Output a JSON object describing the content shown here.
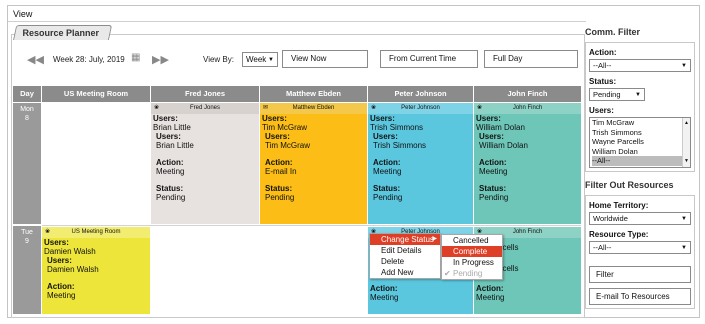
{
  "page": {
    "view_label": "View"
  },
  "planner": {
    "tab_label": "Resource Planner",
    "week_label": "Week 28: July, 2019",
    "view_by_label": "View By:",
    "view_by_value": "Week",
    "view_now": "View Now",
    "from_current_time": "From Current Time",
    "full_day": "Full Day"
  },
  "grid": {
    "headers": [
      "Day",
      "US Meeting Room",
      "Fred Jones",
      "Matthew Ebden",
      "Peter Johnson",
      "John Finch"
    ],
    "days": [
      {
        "name": "Mon",
        "num": "8"
      },
      {
        "name": "Tue",
        "num": "9"
      }
    ],
    "cells": {
      "fred_mon": {
        "header": "Fred Jones",
        "users_label": "Users:",
        "user1": "Brian Little",
        "inner_users_label": "Users:",
        "user2": "Brian Little",
        "action_label": "Action:",
        "action": "Meeting",
        "status_label": "Status:",
        "status": "Pending"
      },
      "matthew_mon": {
        "header": "Matthew Ebden",
        "users_label": "Users:",
        "user1": "Tim McGraw",
        "inner_users_label": "Users:",
        "user2": "Tim McGraw",
        "action_label": "Action:",
        "action": "E-mail In",
        "status_label": "Status:",
        "status": "Pending"
      },
      "peter_mon": {
        "header": "Peter Johnson",
        "users_label": "Users:",
        "user1": "Trish Simmons",
        "inner_users_label": "Users:",
        "user2": "Trish Simmons",
        "action_label": "Action:",
        "action": "Meeting",
        "status_label": "Status:",
        "status": "Pending"
      },
      "john_mon": {
        "header": "John Finch",
        "users_label": "Users:",
        "user1": "William Dolan",
        "inner_users_label": "Users:",
        "user2": "William Dolan",
        "action_label": "Action:",
        "action": "Meeting",
        "status_label": "Status:",
        "status": "Pending"
      },
      "room_tue": {
        "header": "US Meeting Room",
        "users_label": "Users:",
        "user1": "Damien Walsh",
        "inner_users_label": "Users:",
        "user2": "Damien Walsh",
        "action_label": "Action:",
        "action": "Meeting"
      },
      "peter_tue": {
        "header": "Peter Johnson",
        "action_label": "Action:",
        "action": "Meeting"
      },
      "john_tue": {
        "header": "John Finch",
        "user1_partial": "Parcells",
        "user2_partial": "Parcells",
        "action_label": "Action:",
        "action": "Meeting"
      }
    }
  },
  "context_menu": {
    "items": [
      "Change Status",
      "Edit Details",
      "Delete",
      "Add New"
    ],
    "submenu": [
      "Cancelled",
      "Complete",
      "In Progress",
      "Pending"
    ]
  },
  "sidebar": {
    "comm_filter_title": "Comm. Filter",
    "action_label": "Action:",
    "action_value": "--All--",
    "status_label": "Status:",
    "status_value": "Pending",
    "users_label": "Users:",
    "users": [
      "Tim McGraw",
      "Trish Simmons",
      "Wayne Parcells",
      "William Dolan",
      "--All--"
    ],
    "filter_out_title": "Filter Out Resources",
    "home_territory_label": "Home Territory:",
    "home_territory_value": "Worldwide",
    "resource_type_label": "Resource Type:",
    "resource_type_value": "--All--",
    "filter_button": "Filter",
    "email_button": "E-mail To Resources"
  },
  "colors": {
    "fred": "#e7e2df",
    "matthew": "#fbbd16",
    "peter": "#5bc7df",
    "john": "#6dc6b8",
    "room": "#ede53a",
    "highlight": "#de3f27"
  }
}
